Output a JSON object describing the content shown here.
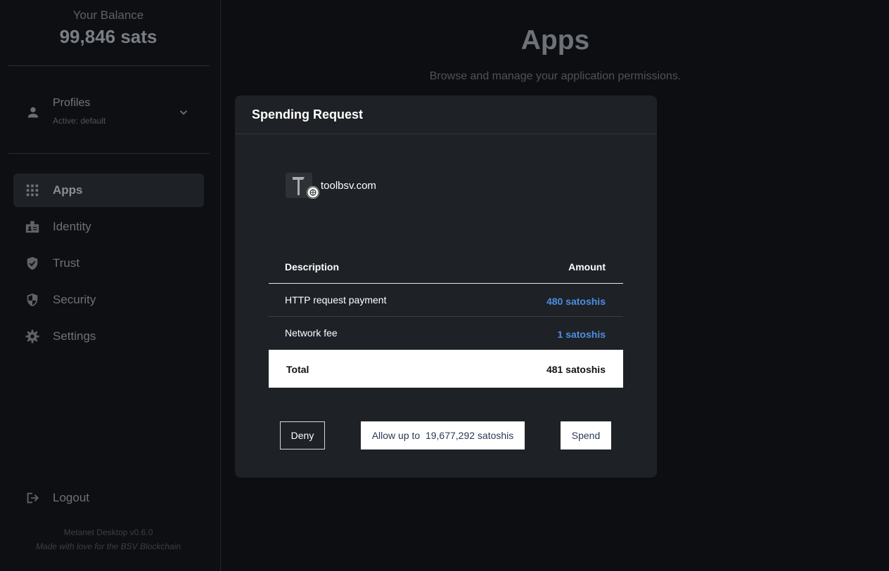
{
  "sidebar": {
    "balance_label": "Your Balance",
    "balance_value": "99,846 sats",
    "profiles": {
      "title": "Profiles",
      "subtitle": "Active: default"
    },
    "nav": [
      {
        "label": "Apps",
        "icon": "apps-grid-icon",
        "active": true
      },
      {
        "label": "Identity",
        "icon": "identity-badge-icon",
        "active": false
      },
      {
        "label": "Trust",
        "icon": "shield-check-icon",
        "active": false
      },
      {
        "label": "Security",
        "icon": "security-shield-icon",
        "active": false
      },
      {
        "label": "Settings",
        "icon": "gear-icon",
        "active": false
      }
    ],
    "logout_label": "Logout",
    "footer_version": "Metanet Desktop v0.6.0",
    "footer_tagline": "Made with love for the BSV Blockchain"
  },
  "main": {
    "title": "Apps",
    "subtitle": "Browse and manage your application permissions."
  },
  "modal": {
    "title": "Spending Request",
    "app_name": "toolbsv.com",
    "app_icon": "hammer-icon",
    "table": {
      "headers": {
        "description": "Description",
        "amount": "Amount"
      },
      "rows": [
        {
          "description": "HTTP request payment",
          "amount": "480 satoshis"
        },
        {
          "description": "Network fee",
          "amount": "1 satoshis"
        }
      ],
      "total": {
        "label": "Total",
        "amount": "481 satoshis"
      }
    },
    "buttons": {
      "deny": "Deny",
      "allow": "Allow up to  19,677,292 satoshis",
      "spend": "Spend"
    }
  },
  "colors": {
    "background": "#0c0e11",
    "modal": "#1e2126",
    "accent_amount": "#4d8fe0"
  }
}
